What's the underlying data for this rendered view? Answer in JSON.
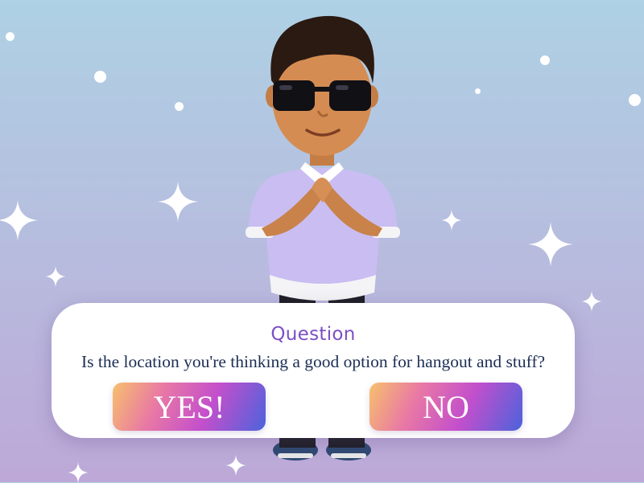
{
  "dialog": {
    "title": "Question",
    "question": "Is the location you're thinking a good option for hangout and stuff?",
    "yes_label": "YES!",
    "no_label": "NO"
  },
  "avatar": {
    "icon": "bitmoji-avatar-icon"
  },
  "decorations": {
    "sparkles": "sparkle-icon",
    "stars": "star-dot-icon"
  },
  "colors": {
    "bg_top": "#aed1e4",
    "bg_bottom": "#bda8d8",
    "title": "#7b4fc4",
    "question": "#1c2f55",
    "button_gradient": [
      "#f7c06c",
      "#e979a4",
      "#c34fcc",
      "#4b63dc"
    ]
  }
}
